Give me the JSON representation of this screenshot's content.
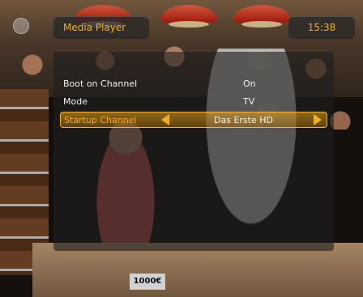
{
  "header": {
    "title": "Media Player",
    "clock": "15:38"
  },
  "settings": [
    {
      "label": "Boot on Channel",
      "value": "On"
    },
    {
      "label": "Mode",
      "value": "TV"
    },
    {
      "label": "Startup Channel",
      "value": "Das Erste HD"
    }
  ],
  "background": {
    "price_tag": "1000€"
  },
  "colors": {
    "accent": "#f0b020",
    "panel": "#1e1e1e"
  },
  "icons": {
    "left": "arrow-left-icon",
    "right": "arrow-right-icon",
    "logo": "logo-icon"
  }
}
